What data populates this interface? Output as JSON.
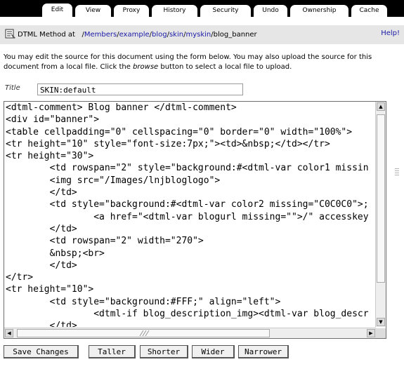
{
  "tabs": [
    {
      "label": "Edit",
      "active": true
    },
    {
      "label": "View",
      "active": false
    },
    {
      "label": "Proxy",
      "active": false
    },
    {
      "label": "History",
      "active": false
    },
    {
      "label": "Security",
      "active": false
    },
    {
      "label": "Undo",
      "active": false
    },
    {
      "label": "Ownership",
      "active": false
    },
    {
      "label": "Cache",
      "active": false
    }
  ],
  "header": {
    "object_type": "DTML Method at",
    "path": [
      "Members",
      "example",
      "blog",
      "skin",
      "myskin"
    ],
    "object_id": "blog_banner",
    "help_label": "Help!"
  },
  "intro": {
    "text_before": "You may edit the source for this document using the form below. You may also upload the source for this document from a local file. Click the ",
    "emphasis": "browse",
    "text_after": " button to select a local file to upload."
  },
  "title_field": {
    "label": "Title",
    "value": "SKIN:default"
  },
  "source_lines": [
    "<dtml-comment> Blog banner </dtml-comment>",
    "<div id=\"banner\">",
    "<table cellpadding=\"0\" cellspacing=\"0\" border=\"0\" width=\"100%\">",
    "<tr height=\"10\" style=\"font-size:7px;\"><td>&nbsp;</td></tr>",
    "<tr height=\"30\">",
    "        <td rowspan=\"2\" style=\"background:#<dtml-var color1 missin",
    "        <img src=\"/Images/lnjbloglogo\">",
    "        </td>",
    "        <td style=\"background:#<dtml-var color2 missing=\"C0C0C0\">;",
    "                <a href=\"<dtml-var blogurl missing=\"\">/\" accesskey",
    "        </td>",
    "        <td rowspan=\"2\" width=\"270\">",
    "        &nbsp;<br>",
    "        </td>",
    "</tr>",
    "<tr height=\"10\">",
    "        <td style=\"background:#FFF;\" align=\"left\">",
    "                <dtml-if blog_description_img><dtml-var blog_descr",
    "        </td>"
  ],
  "buttons": {
    "save": "Save Changes",
    "taller": "Taller",
    "shorter": "Shorter",
    "wider": "Wider",
    "narrower": "Narrower"
  },
  "colors": {
    "tabbar": "#000000",
    "header_bg": "#e6e6e6",
    "link": "#1a1aa8"
  }
}
